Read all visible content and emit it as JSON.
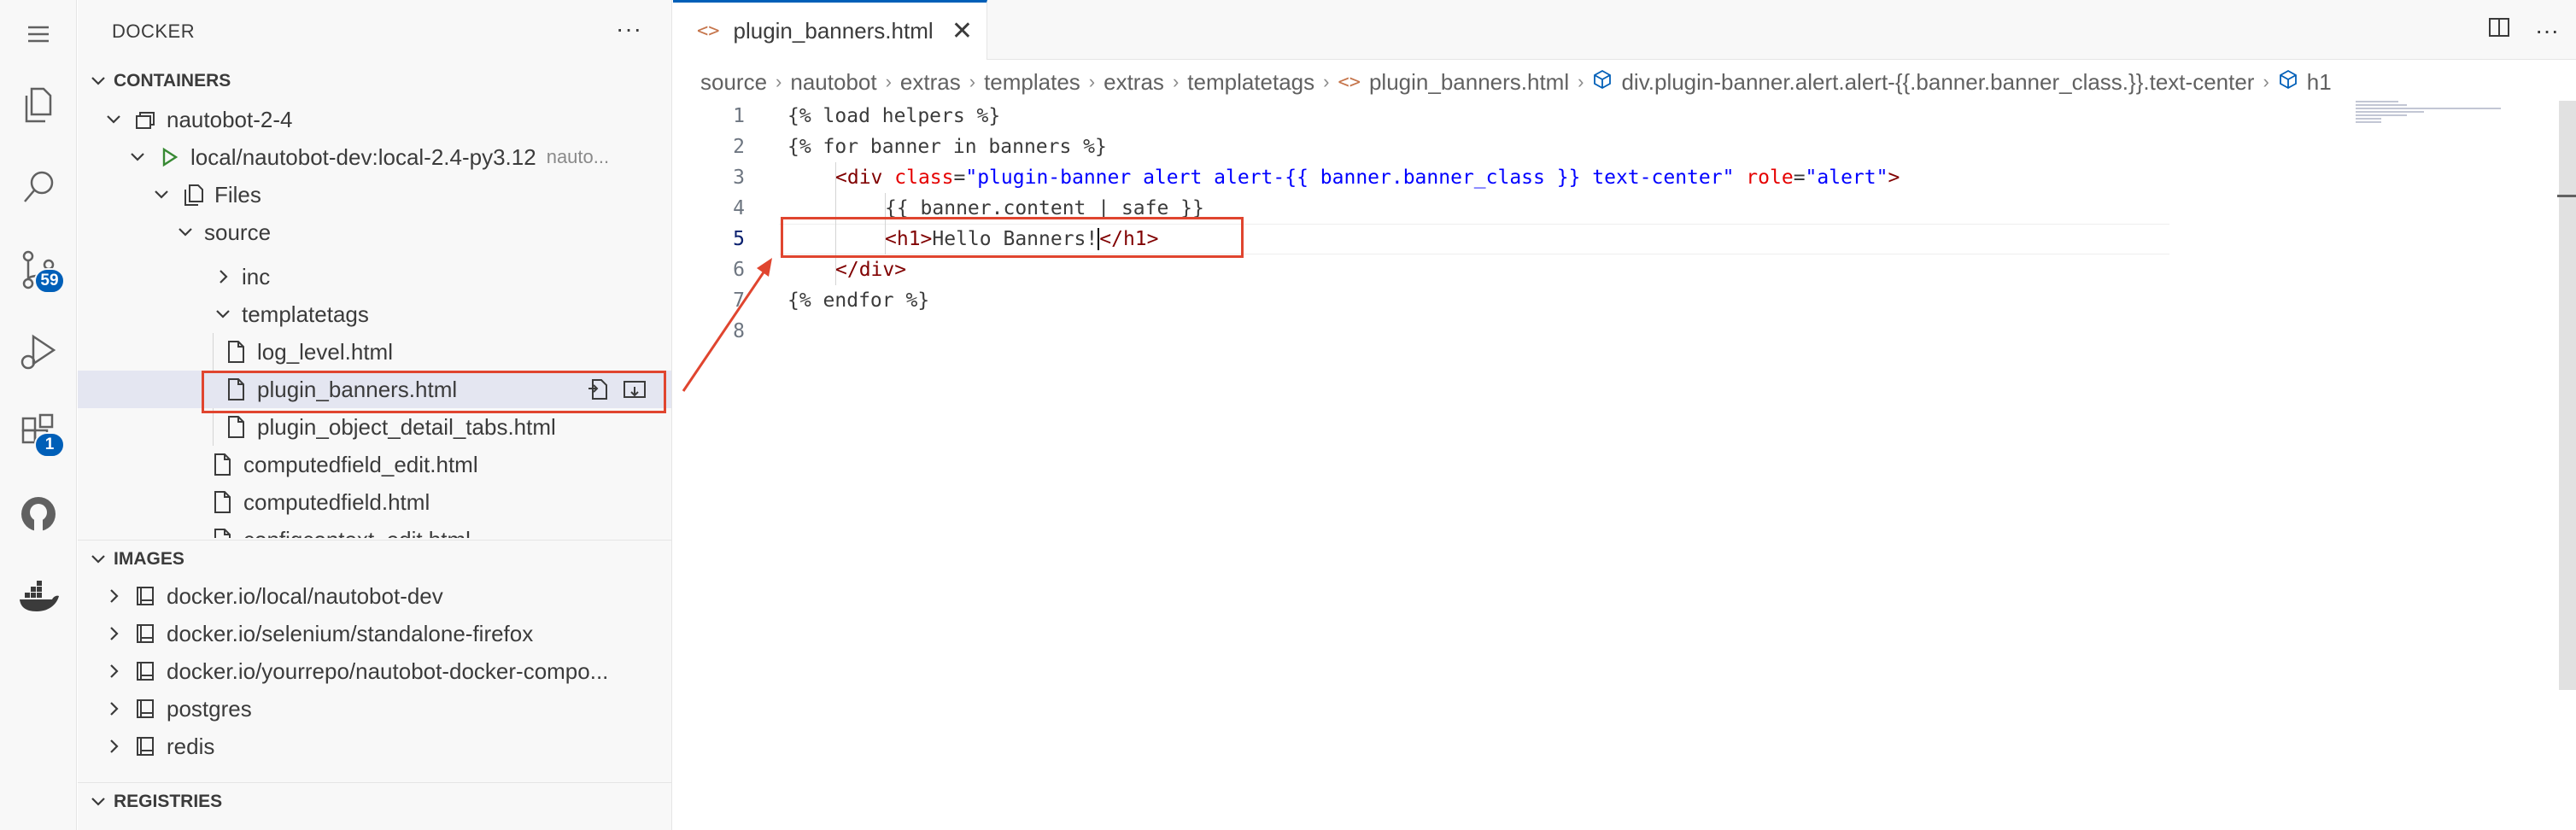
{
  "sidebar": {
    "title": "DOCKER",
    "containers_header": "CONTAINERS",
    "container_name": "nautobot-2-4",
    "image_run": "local/nautobot-dev:local-2.4-py3.12",
    "image_run_extra": "nauto...",
    "files_label": "Files",
    "source_label": "source",
    "inc_label": "inc",
    "templatetags_label": "templatetags",
    "files": [
      "log_level.html",
      "plugin_banners.html",
      "plugin_object_detail_tabs.html",
      "computedfield_edit.html",
      "computedfield.html",
      "configcontext_edit.html"
    ],
    "images_header": "IMAGES",
    "images": [
      "docker.io/local/nautobot-dev",
      "docker.io/selenium/standalone-firefox",
      "docker.io/yourrepo/nautobot-docker-compo...",
      "postgres",
      "redis"
    ],
    "registries_header": "REGISTRIES"
  },
  "activity": {
    "source_control_badge": "59",
    "extensions_badge": "1"
  },
  "editor": {
    "tab_label": "plugin_banners.html",
    "breadcrumbs": [
      "source",
      "nautobot",
      "extras",
      "templates",
      "extras",
      "templatetags",
      "plugin_banners.html",
      "div.plugin-banner.alert.alert-{{.banner.banner_class.}}.text-center",
      "h1"
    ],
    "line_numbers": [
      "1",
      "2",
      "3",
      "4",
      "5",
      "6",
      "7",
      "8"
    ],
    "code": {
      "l1": "{% load helpers %}",
      "l2": "{% for banner in banners %}",
      "l3_open": "<div",
      "l3_attr1": "class",
      "l3_eq1": "=",
      "l3_val1": "\"plugin-banner alert alert-{{ banner.banner_class }} text-center\"",
      "l3_attr2": "role",
      "l3_eq2": "=",
      "l3_val2": "\"alert\"",
      "l3_close": ">",
      "l4": "{{ banner.content | safe }}",
      "l5_open": "<h1>",
      "l5_text": "Hello Banners!",
      "l5_close": "</h1>",
      "l6": "</div>",
      "l7": "{% endfor %}"
    }
  },
  "colors": {
    "accent": "#005fb8",
    "highlight_box": "#e0452f",
    "selected_row": "#e4e6f1"
  }
}
